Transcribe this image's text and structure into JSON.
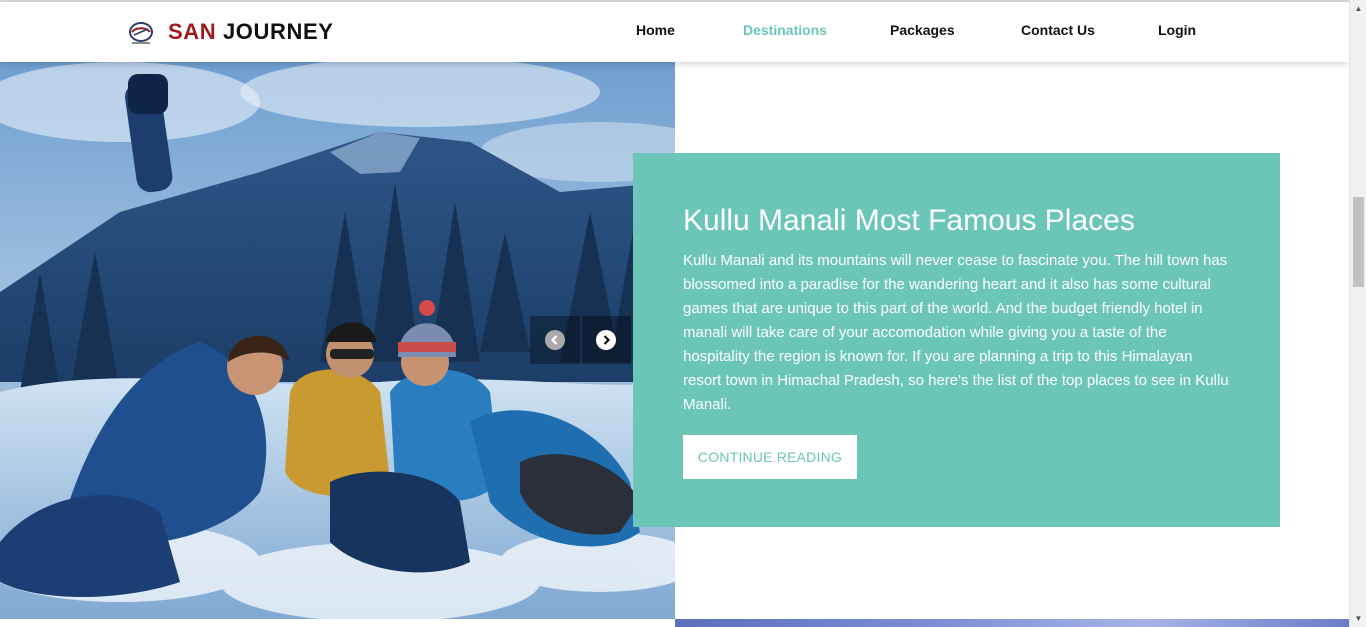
{
  "brand": {
    "name_accent": "SAN",
    "name_rest": "JOURNEY",
    "accent_color": "#9b1b1b"
  },
  "nav": {
    "items": [
      {
        "label": "Home",
        "active": false
      },
      {
        "label": "Destinations",
        "active": true
      },
      {
        "label": "Packages",
        "active": false
      },
      {
        "label": "Contact Us",
        "active": false
      },
      {
        "label": "Login",
        "active": false
      }
    ],
    "active_color": "#6cc6b8"
  },
  "hero": {
    "image_subject": "friends-in-snow-photo",
    "prev_icon": "chevron-left-circle-icon",
    "next_icon": "chevron-right-circle-icon"
  },
  "card": {
    "title": "Kullu Manali Most Famous Places",
    "body": "Kullu Manali and its mountains will never cease to fascinate you. The hill town has blossomed into a paradise for the wandering heart and it also has some cultural games that are unique to this part of the world. And the budget friendly hotel in manali will take care of your accomodation while giving you a taste of the hospitality the region is known for. If you are planning a trip to this Himalayan resort town in Himachal Pradesh, so here's the list of the top places to see in Kullu Manali.",
    "button_label": "CONTINUE READING",
    "background_color": "#6cc6b8"
  }
}
